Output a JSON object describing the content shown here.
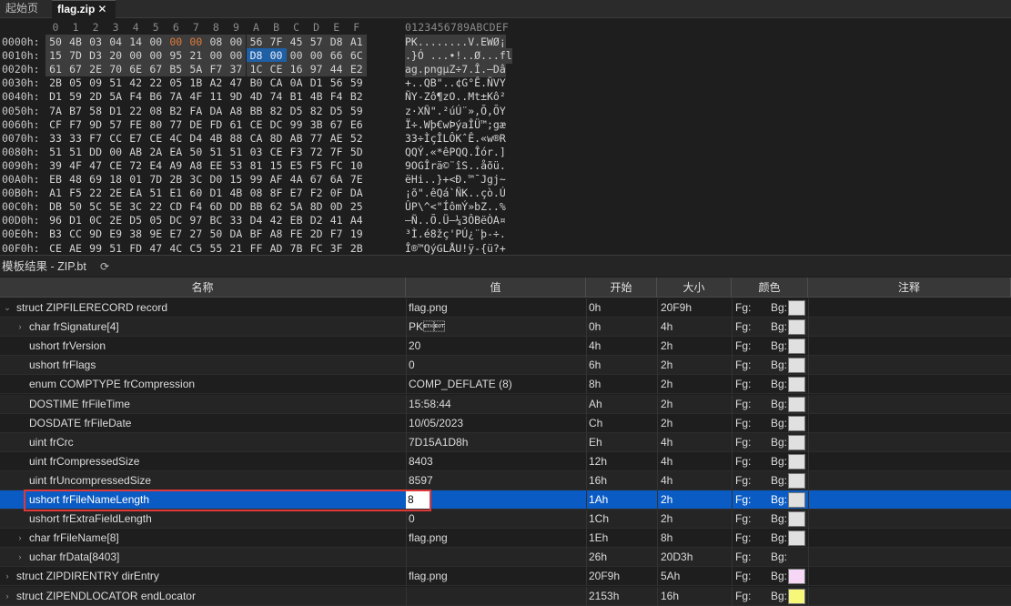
{
  "tabs": [
    {
      "label": "起始页",
      "active": false
    },
    {
      "label": "flag.zip",
      "active": true,
      "close": "✕"
    }
  ],
  "hex_view": {
    "column_headers": [
      "0",
      "1",
      "2",
      "3",
      "4",
      "5",
      "6",
      "7",
      "8",
      "9",
      "A",
      "B",
      "C",
      "D",
      "E",
      "F"
    ],
    "ascii_header": "0123456789ABCDEF",
    "rows": [
      {
        "addr": "0000h:",
        "bytes": [
          "50",
          "4B",
          "03",
          "04",
          "14",
          "00",
          "00",
          "00",
          "08",
          "00",
          "56",
          "7F",
          "45",
          "57",
          "D8",
          "A1"
        ],
        "ascii": "PK........V.EWØ¡"
      },
      {
        "addr": "0010h:",
        "bytes": [
          "15",
          "7D",
          "D3",
          "20",
          "00",
          "00",
          "95",
          "21",
          "00",
          "00",
          "D8",
          "00",
          "00",
          "00",
          "66",
          "6C"
        ],
        "ascii": ".}Ó ...•!..Ø...fl"
      },
      {
        "addr": "0020h:",
        "bytes": [
          "61",
          "67",
          "2E",
          "70",
          "6E",
          "67",
          "B5",
          "5A",
          "F7",
          "37",
          "1C",
          "CE",
          "16",
          "97",
          "44",
          "E2"
        ],
        "ascii": "ag.pngµZ÷7.Î.—Dâ"
      },
      {
        "addr": "0030h:",
        "bytes": [
          "2B",
          "05",
          "09",
          "51",
          "42",
          "22",
          "05",
          "1B",
          "A2",
          "47",
          "B0",
          "CA",
          "0A",
          "D1",
          "56",
          "59"
        ],
        "ascii": "+..QB\"..¢G°Ê.ÑVY"
      },
      {
        "addr": "0040h:",
        "bytes": [
          "D1",
          "59",
          "2D",
          "5A",
          "F4",
          "B6",
          "7A",
          "4F",
          "11",
          "9D",
          "4D",
          "74",
          "B1",
          "4B",
          "F4",
          "B2"
        ],
        "ascii": "ÑY-Zô¶zO..Mt±Kô²"
      },
      {
        "addr": "0050h:",
        "bytes": [
          "7A",
          "B7",
          "58",
          "D1",
          "22",
          "08",
          "B2",
          "FA",
          "DA",
          "A8",
          "BB",
          "82",
          "D5",
          "82",
          "D5",
          "59"
        ],
        "ascii": "z·XÑ\".²úÚ¨»‚Õ‚ÕY"
      },
      {
        "addr": "0060h:",
        "bytes": [
          "CF",
          "F7",
          "9D",
          "57",
          "FE",
          "80",
          "77",
          "DE",
          "FD",
          "61",
          "CE",
          "DC",
          "99",
          "3B",
          "67",
          "E6"
        ],
        "ascii": "Ï÷.Wþ€wÞýaÎÜ™;gæ"
      },
      {
        "addr": "0070h:",
        "bytes": [
          "33",
          "33",
          "F7",
          "CC",
          "E7",
          "CE",
          "4C",
          "D4",
          "4B",
          "88",
          "CA",
          "8D",
          "AB",
          "77",
          "AE",
          "52"
        ],
        "ascii": "33÷ÌçÎLÔKˆÊ.«w®R"
      },
      {
        "addr": "0080h:",
        "bytes": [
          "51",
          "51",
          "DD",
          "00",
          "AB",
          "2A",
          "EA",
          "50",
          "51",
          "51",
          "03",
          "CE",
          "F3",
          "72",
          "7F",
          "5D"
        ],
        "ascii": "QQÝ.«*êPQQ.Îór.]"
      },
      {
        "addr": "0090h:",
        "bytes": [
          "39",
          "4F",
          "47",
          "CE",
          "72",
          "E4",
          "A9",
          "A8",
          "EE",
          "53",
          "81",
          "15",
          "E5",
          "F5",
          "FC",
          "10"
        ],
        "ascii": "9OGÎrä©¨îS..åõü."
      },
      {
        "addr": "00A0h:",
        "bytes": [
          "EB",
          "48",
          "69",
          "18",
          "01",
          "7D",
          "2B",
          "3C",
          "D0",
          "15",
          "99",
          "AF",
          "4A",
          "67",
          "6A",
          "7E"
        ],
        "ascii": "ëHi..}+<Ð.™¯Jgj~"
      },
      {
        "addr": "00B0h:",
        "bytes": [
          "A1",
          "F5",
          "22",
          "2E",
          "EA",
          "51",
          "E1",
          "60",
          "D1",
          "4B",
          "08",
          "8F",
          "E7",
          "F2",
          "0F",
          "DA"
        ],
        "ascii": "¡õ\".êQá`ÑK..çò.Ú"
      },
      {
        "addr": "00C0h:",
        "bytes": [
          "DB",
          "50",
          "5C",
          "5E",
          "3C",
          "22",
          "CD",
          "F4",
          "6D",
          "DD",
          "BB",
          "62",
          "5A",
          "8D",
          "0D",
          "25"
        ],
        "ascii": "ÛP\\^<\"ÍômÝ»bZ..%"
      },
      {
        "addr": "00D0h:",
        "bytes": [
          "96",
          "D1",
          "0C",
          "2E",
          "D5",
          "05",
          "DC",
          "97",
          "BC",
          "33",
          "D4",
          "42",
          "EB",
          "D2",
          "41",
          "A4"
        ],
        "ascii": "–Ñ..Õ.Ü—¼3ÔBëÒA¤"
      },
      {
        "addr": "00E0h:",
        "bytes": [
          "B3",
          "CC",
          "9D",
          "E9",
          "38",
          "9E",
          "E7",
          "27",
          "50",
          "DA",
          "BF",
          "A8",
          "FE",
          "2D",
          "F7",
          "19"
        ],
        "ascii": "³Ì.é8žç'PÚ¿¨þ-÷."
      },
      {
        "addr": "00F0h:",
        "bytes": [
          "CE",
          "AE",
          "99",
          "51",
          "FD",
          "47",
          "4C",
          "C5",
          "55",
          "21",
          "FF",
          "AD",
          "7B",
          "FC",
          "3F",
          "2B"
        ],
        "ascii": "Î®™QýGLÅU!ÿ-{ü?+"
      }
    ],
    "selected_rows": 3
  },
  "template_panel": {
    "title": "模板结果 - ZIP.bt",
    "refresh_icon": "⟳"
  },
  "table": {
    "headers": {
      "name": "名称",
      "value": "值",
      "start": "开始",
      "size": "大小",
      "color": "颜色",
      "comment": "注释"
    },
    "rows": [
      {
        "indent": 0,
        "expander": "open",
        "name": "struct ZIPFILERECORD record",
        "value": "flag.png",
        "start": "0h",
        "size": "20F9h",
        "fg": "Fg:",
        "bg": "Bg:",
        "swatch": "#e0e0e0"
      },
      {
        "indent": 1,
        "expander": "closed",
        "name": "char frSignature[4]",
        "value": "PK\u0003\u0004",
        "start": "0h",
        "size": "4h",
        "fg": "Fg:",
        "bg": "Bg:",
        "swatch": "#e0e0e0"
      },
      {
        "indent": 1,
        "expander": "",
        "name": "ushort frVersion",
        "value": "20",
        "start": "4h",
        "size": "2h",
        "fg": "Fg:",
        "bg": "Bg:",
        "swatch": "#e0e0e0"
      },
      {
        "indent": 1,
        "expander": "",
        "name": "ushort frFlags",
        "value": "0",
        "start": "6h",
        "size": "2h",
        "fg": "Fg:",
        "bg": "Bg:",
        "swatch": "#e0e0e0"
      },
      {
        "indent": 1,
        "expander": "",
        "name": "enum COMPTYPE frCompression",
        "value": "COMP_DEFLATE (8)",
        "start": "8h",
        "size": "2h",
        "fg": "Fg:",
        "bg": "Bg:",
        "swatch": "#e0e0e0"
      },
      {
        "indent": 1,
        "expander": "",
        "name": "DOSTIME frFileTime",
        "value": "15:58:44",
        "start": "Ah",
        "size": "2h",
        "fg": "Fg:",
        "bg": "Bg:",
        "swatch": "#e0e0e0"
      },
      {
        "indent": 1,
        "expander": "",
        "name": "DOSDATE frFileDate",
        "value": "10/05/2023",
        "start": "Ch",
        "size": "2h",
        "fg": "Fg:",
        "bg": "Bg:",
        "swatch": "#e0e0e0"
      },
      {
        "indent": 1,
        "expander": "",
        "name": "uint frCrc",
        "value": "7D15A1D8h",
        "start": "Eh",
        "size": "4h",
        "fg": "Fg:",
        "bg": "Bg:",
        "swatch": "#e0e0e0"
      },
      {
        "indent": 1,
        "expander": "",
        "name": "uint frCompressedSize",
        "value": "8403",
        "start": "12h",
        "size": "4h",
        "fg": "Fg:",
        "bg": "Bg:",
        "swatch": "#e0e0e0"
      },
      {
        "indent": 1,
        "expander": "",
        "name": "uint frUncompressedSize",
        "value": "8597",
        "start": "16h",
        "size": "4h",
        "fg": "Fg:",
        "bg": "Bg:",
        "swatch": "#e0e0e0"
      },
      {
        "indent": 1,
        "expander": "",
        "name": "ushort frFileNameLength",
        "value": "8",
        "start": "1Ah",
        "size": "2h",
        "fg": "Fg:",
        "bg": "Bg:",
        "swatch": "#e0e0e0",
        "selected": true
      },
      {
        "indent": 1,
        "expander": "",
        "name": "ushort frExtraFieldLength",
        "value": "0",
        "start": "1Ch",
        "size": "2h",
        "fg": "Fg:",
        "bg": "Bg:",
        "swatch": "#e0e0e0"
      },
      {
        "indent": 1,
        "expander": "closed",
        "name": "char frFileName[8]",
        "value": "flag.png",
        "start": "1Eh",
        "size": "8h",
        "fg": "Fg:",
        "bg": "Bg:",
        "swatch": "#e0e0e0"
      },
      {
        "indent": 1,
        "expander": "closed",
        "name": "uchar frData[8403]",
        "value": "",
        "start": "26h",
        "size": "20D3h",
        "fg": "Fg:",
        "bg": "Bg:",
        "swatch": ""
      },
      {
        "indent": 0,
        "expander": "closed",
        "name": "struct ZIPDIRENTRY dirEntry",
        "value": "flag.png",
        "start": "20F9h",
        "size": "5Ah",
        "fg": "Fg:",
        "bg": "Bg:",
        "swatch": "#f6d8f6"
      },
      {
        "indent": 0,
        "expander": "closed",
        "name": "struct ZIPENDLOCATOR endLocator",
        "value": "",
        "start": "2153h",
        "size": "16h",
        "fg": "Fg:",
        "bg": "Bg:",
        "swatch": "#f7f77a"
      }
    ]
  },
  "colors": {
    "selection": "#0a5bc4",
    "highlight_box": "#e03838",
    "hex_orange": "#e07b39",
    "hex_blue": "#1f5fa3"
  }
}
